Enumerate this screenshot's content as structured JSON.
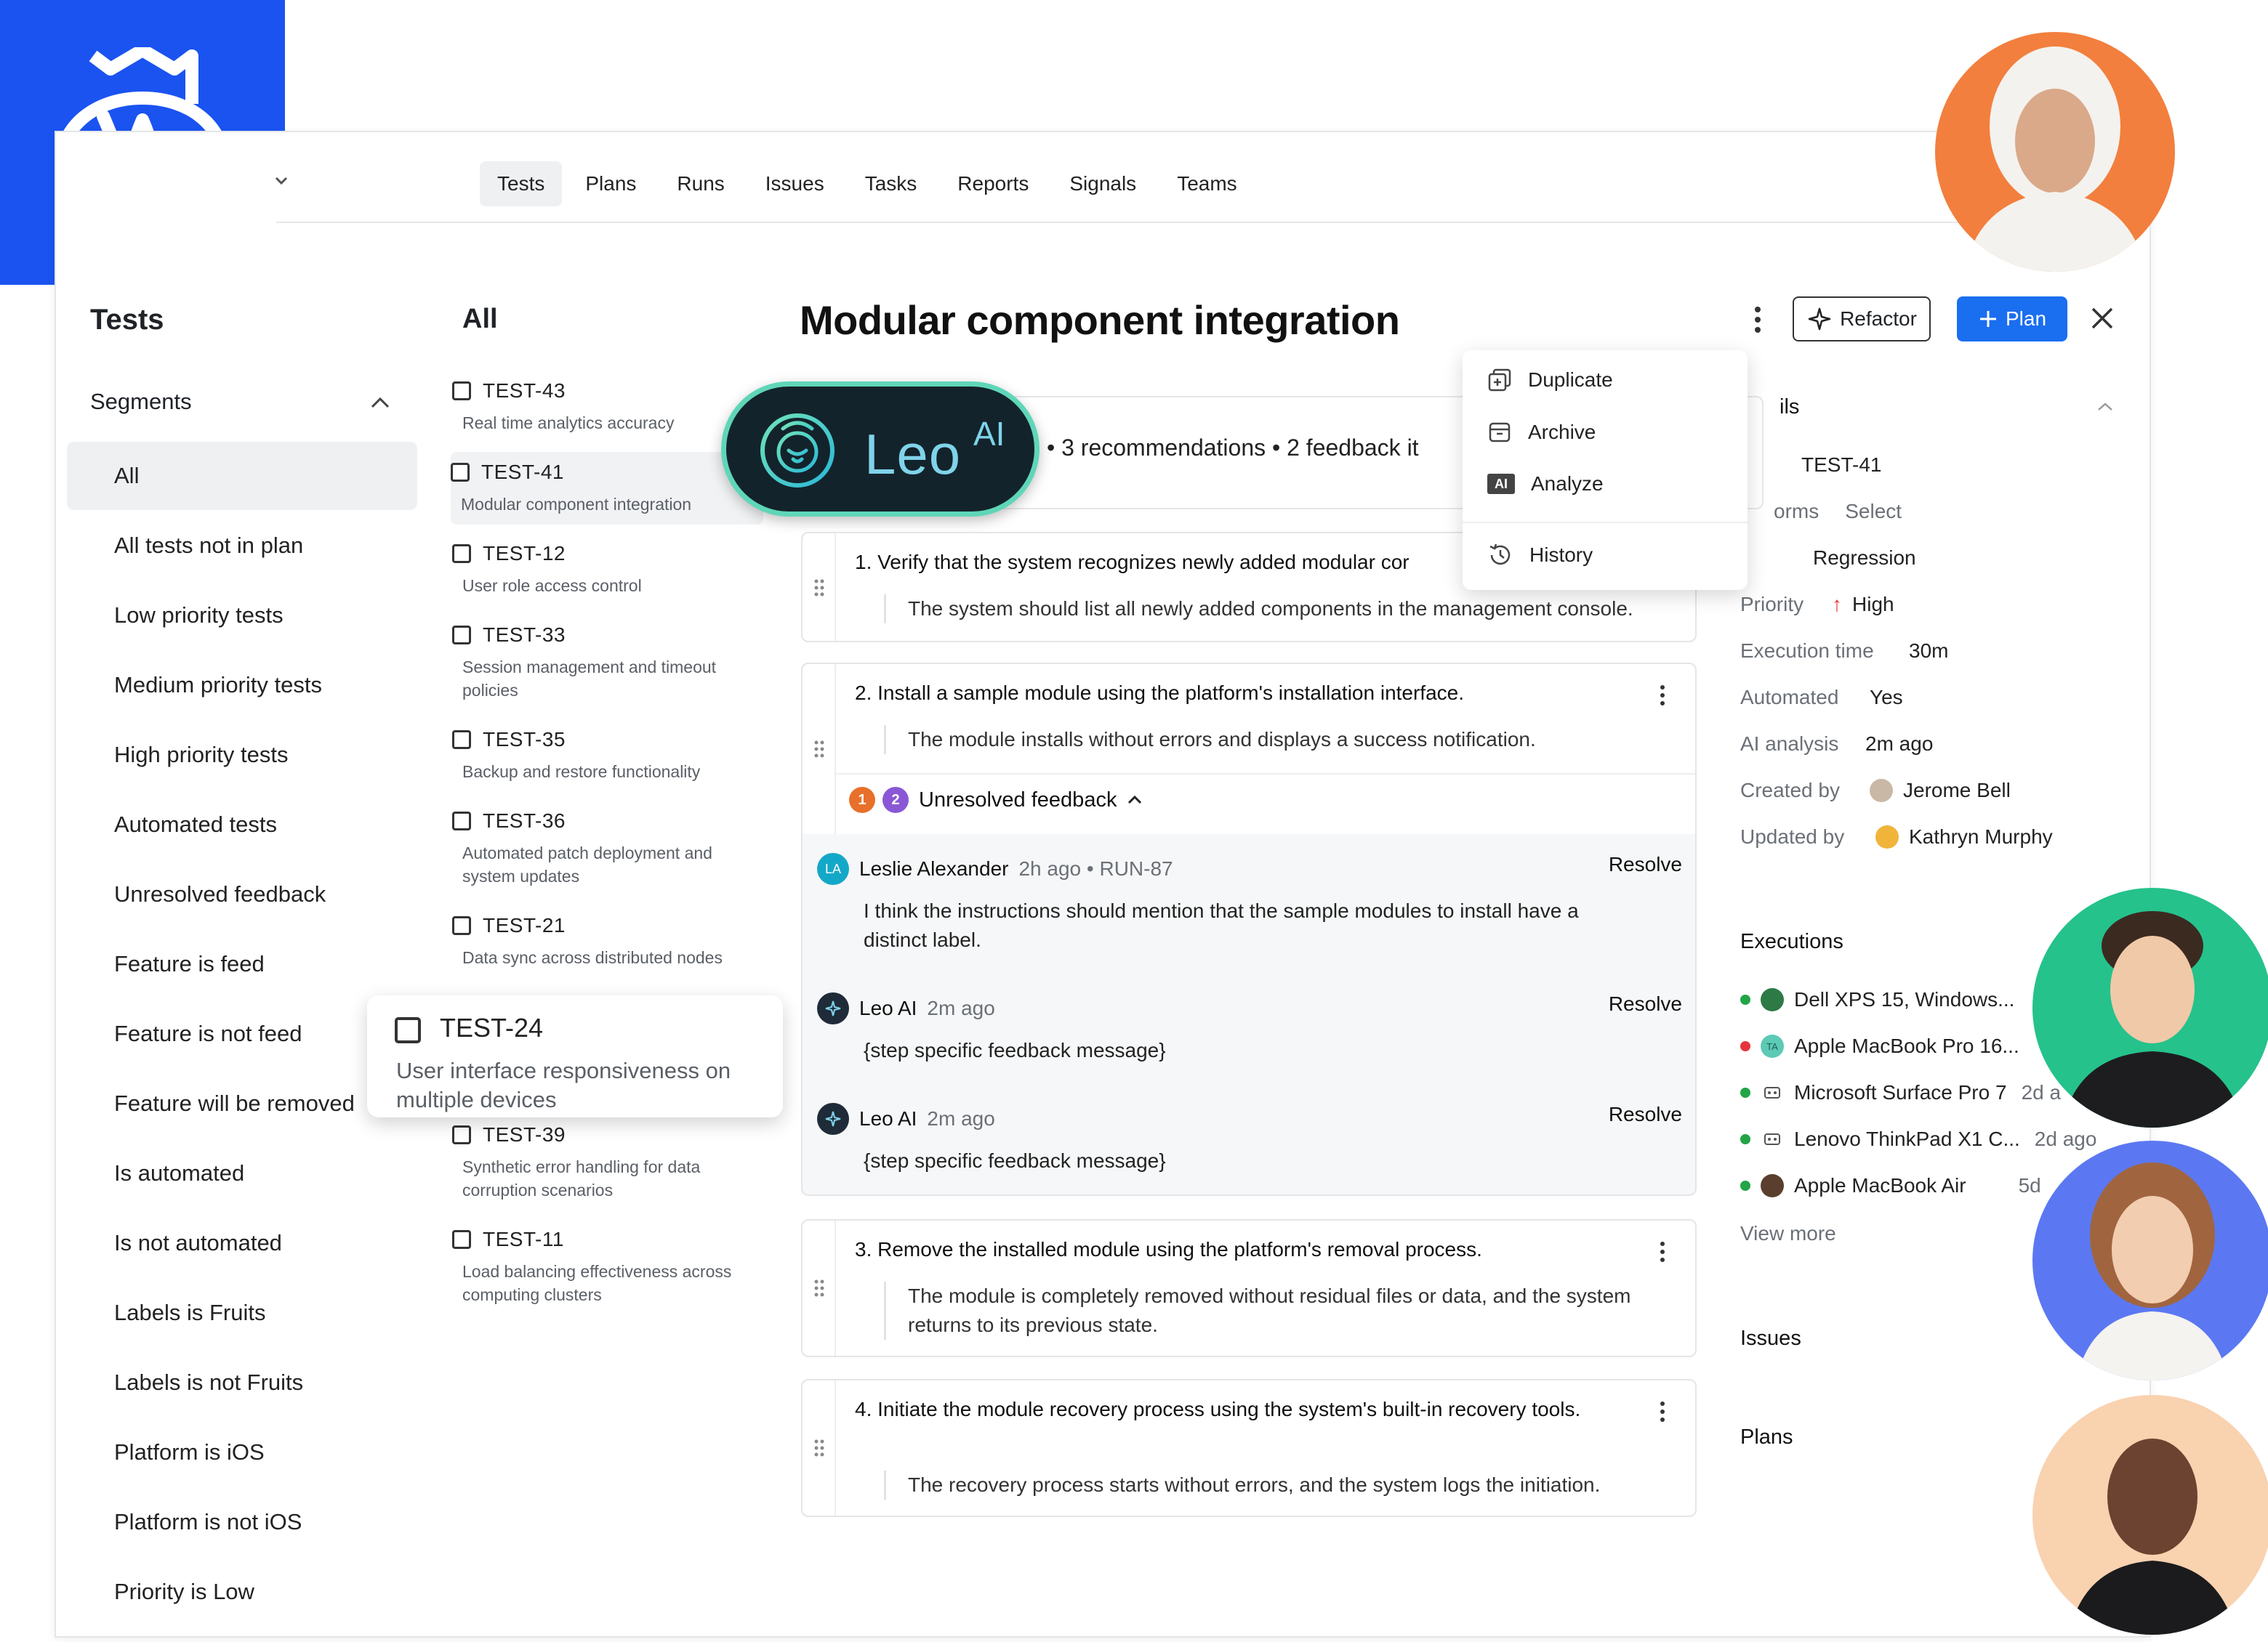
{
  "nav": {
    "tabs": [
      {
        "label": "Tests"
      },
      {
        "label": "Plans"
      },
      {
        "label": "Runs"
      },
      {
        "label": "Issues"
      },
      {
        "label": "Tasks"
      },
      {
        "label": "Reports"
      },
      {
        "label": "Signals"
      },
      {
        "label": "Teams"
      }
    ],
    "active": "Tests"
  },
  "sidebar": {
    "title": "Tests",
    "segments_label": "Segments",
    "items": [
      "All",
      "All tests not in plan",
      "Low priority tests",
      "Medium priority tests",
      "High priority tests",
      "Automated tests",
      "Unresolved feedback",
      "Feature is feed",
      "Feature is not feed",
      "Feature will be removed",
      "Is automated",
      "Is not automated",
      "Labels is Fruits",
      "Labels is not Fruits",
      "Platform is iOS",
      "Platform is not iOS",
      "Priority is Low"
    ]
  },
  "list": {
    "title": "All",
    "tests": [
      {
        "code": "TEST-43",
        "desc": "Real time analytics accuracy"
      },
      {
        "code": "TEST-41",
        "desc": "Modular component integration"
      },
      {
        "code": "TEST-12",
        "desc": "User role access control"
      },
      {
        "code": "TEST-33",
        "desc": "Session management and timeout policies"
      },
      {
        "code": "TEST-35",
        "desc": "Backup and restore functionality"
      },
      {
        "code": "TEST-36",
        "desc": "Automated patch deployment and system updates"
      },
      {
        "code": "TEST-21",
        "desc": "Data sync across distributed nodes"
      },
      {
        "code": "TEST-39",
        "desc": "Synthetic error handling for data corruption scenarios"
      },
      {
        "code": "TEST-11",
        "desc": "Load balancing effectiveness across computing clusters"
      }
    ],
    "floating": {
      "code": "TEST-24",
      "desc": "User interface responsiveness on multiple devices"
    }
  },
  "detail": {
    "title": "Modular component integration",
    "refactor_label": "Refactor",
    "plan_label": "Plan",
    "leo": {
      "name": "Leo",
      "sup": "AI",
      "summary": "• 3 recommendations • 2 feedback it"
    },
    "steps": [
      {
        "num": "1.",
        "title": "Verify that the system recognizes newly added modular cor",
        "expected": "The system should list all newly added components in the management console."
      },
      {
        "num": "2.",
        "title": "Install a sample module using the platform's installation interface.",
        "expected": "The module installs without errors and displays a success notification."
      },
      {
        "num": "3.",
        "title": "Remove the installed module using the platform's removal process.",
        "expected": "The module is completely removed without residual files or data, and the system returns to its previous state."
      },
      {
        "num": "4.",
        "title": "Initiate the module recovery process using the system's built-in recovery tools.",
        "expected": "The recovery process starts without errors, and the system logs the initiation."
      }
    ],
    "feedback": {
      "badge1": "1",
      "badge2": "2",
      "label": "Unresolved feedback",
      "items": [
        {
          "initials": "LA",
          "name": "Leslie Alexander",
          "when": "2h ago • RUN-87",
          "action": "Resolve",
          "text": "I think the instructions should mention that the sample modules to install have a distinct label."
        },
        {
          "name": "Leo AI",
          "when": "2m ago",
          "action": "Resolve",
          "text": "{step specific feedback message}"
        },
        {
          "name": "Leo AI",
          "when": "2m ago",
          "action": "Resolve",
          "text": "{step specific feedback message}"
        }
      ]
    }
  },
  "menu": {
    "items": [
      {
        "label": "Duplicate",
        "icon": "duplicate-icon"
      },
      {
        "label": "Archive",
        "icon": "archive-icon"
      },
      {
        "label": "Analyze",
        "icon": "ai-icon",
        "icon_text": "AI"
      },
      {
        "label": "History",
        "icon": "history-icon"
      }
    ]
  },
  "details": {
    "section_fragment": "ils",
    "id": "TEST-41",
    "platforms_fragment": "orms",
    "platforms_value": "Select",
    "type_value": "Regression",
    "rows": [
      {
        "key": "Priority",
        "value": "High"
      },
      {
        "key": "Execution time",
        "value": "30m"
      },
      {
        "key": "Automated",
        "value": "Yes"
      },
      {
        "key": "AI analysis",
        "value": "2m ago"
      },
      {
        "key": "Created by",
        "value": "Jerome Bell"
      },
      {
        "key": "Updated by",
        "value": "Kathryn Murphy"
      }
    ],
    "executions_label": "Executions",
    "executions": [
      {
        "device": "Dell XPS 15, Windows...",
        "status": "#22a447",
        "when": ""
      },
      {
        "device": "Apple MacBook Pro 16...",
        "status": "#e5343b",
        "when": "",
        "initials": "TA"
      },
      {
        "device": "Microsoft Surface Pro 7",
        "status": "#22a447",
        "when": "2d a"
      },
      {
        "device": "Lenovo ThinkPad X1 C...",
        "status": "#22a447",
        "when": "2d ago"
      },
      {
        "device": "Apple MacBook Air",
        "status": "#22a447",
        "when": "5d"
      }
    ],
    "view_more": "View more",
    "issues_label": "Issues",
    "plans_label": "Plans"
  },
  "colors": {
    "brand": "#1a53f0",
    "primary": "#1a6ef0",
    "leo_border": "#5fd6b8",
    "priority_high": "#e5343b"
  }
}
